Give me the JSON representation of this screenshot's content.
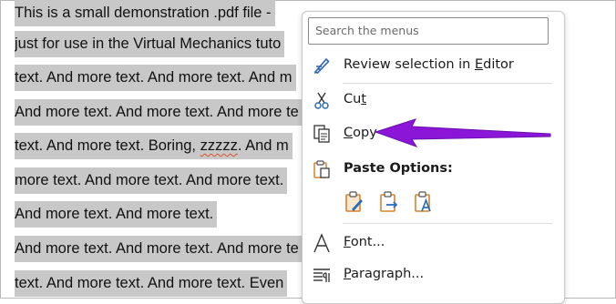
{
  "document": {
    "lines": [
      "This is a small demonstration .pdf file -",
      "just for use in the Virtual Mechanics tuto",
      "text. And more text. And more text. And m",
      "And more text. And more text. And more te",
      "text. And more text. Boring, ",
      "more text. And more text. And more text. ",
      "And more text. And more text.",
      "And more text. And more text. And more te",
      "text. And more text. And more text. Even"
    ],
    "squiggle_word": "zzzzz",
    "line5_tail": ". And m"
  },
  "menu": {
    "search_placeholder": "Search the menus",
    "review": {
      "pre": "Review selection in ",
      "key": "E",
      "post": "ditor"
    },
    "cut": {
      "pre": "Cu",
      "key": "t",
      "post": ""
    },
    "copy": {
      "pre": "",
      "key": "C",
      "post": "opy"
    },
    "paste_heading": "Paste Options:",
    "font": {
      "pre": "",
      "key": "F",
      "post": "ont..."
    },
    "paragraph": {
      "pre": "",
      "key": "P",
      "post": "aragraph..."
    }
  },
  "colors": {
    "arrow": "#8b16d8",
    "selection": "#c8c8c8",
    "paste_orange": "#d9822b",
    "paste_blue": "#2a6fb6"
  }
}
